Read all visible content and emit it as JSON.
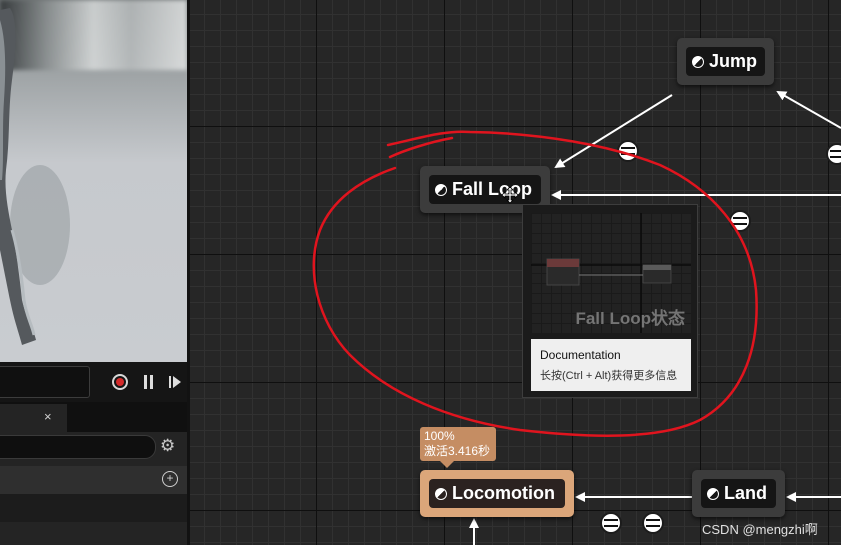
{
  "viewport": {
    "title": ""
  },
  "controls": {
    "time_value": ""
  },
  "tabs": {
    "close_glyph": "×"
  },
  "panel": {
    "gear_glyph": "⚙",
    "add_glyph": "+"
  },
  "states": {
    "jump": "Jump",
    "fall_loop": "Fall Loop",
    "locomotion": "Locomotion",
    "land": "Land"
  },
  "tooltip": {
    "preview_label": "Fall Loop状态",
    "doc_title": "Documentation",
    "doc_hint": "长按(Ctrl + Alt)获得更多信息"
  },
  "badge": {
    "weight": "100%",
    "active": "激活3.416秒"
  },
  "watermark": "CSDN @mengzhi啊",
  "colors": {
    "active_state": "#dba67a",
    "annotation": "#e0141e",
    "grid_major": "#0f0f0f",
    "grid_minor": "#313131"
  },
  "icons": [
    "state-icon",
    "transition-icon",
    "record-icon",
    "pause-icon",
    "step-forward-icon",
    "gear-icon",
    "add-circle-icon",
    "close-icon",
    "move-cursor-icon"
  ]
}
